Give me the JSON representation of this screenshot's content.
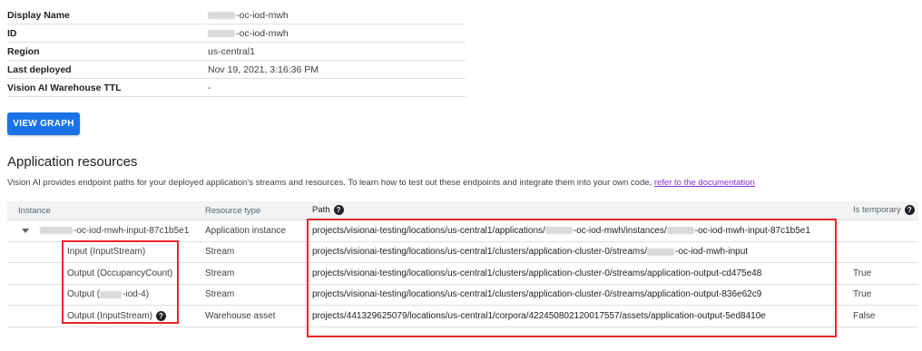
{
  "properties": [
    {
      "key": "Display Name",
      "value": "-oc-iod-mwh"
    },
    {
      "key": "ID",
      "value": "-oc-iod-mwh"
    },
    {
      "key": "Region",
      "value": "us-central1"
    },
    {
      "key": "Last deployed",
      "value": "Nov 19, 2021, 3:16:36 PM"
    },
    {
      "key": "Vision AI Warehouse TTL",
      "value": "-"
    }
  ],
  "view_graph_label": "VIEW GRAPH",
  "resources": {
    "title": "Application resources",
    "description": "Vision AI provides endpoint paths for your deployed application's streams and resources. To learn how to test out these endpoints and integrate them into your own code,",
    "doc_link": "refer to the documentation",
    "columns": {
      "instance": "Instance",
      "type": "Resource type",
      "path": "Path",
      "temporary": "Is temporary"
    },
    "rows": [
      {
        "instance_suffix": "-oc-iod-mwh-input-87c1b5e1",
        "type": "Application instance",
        "path_a": "projects/visionai-testing/locations/us-central1/applications/",
        "path_b": "-oc-iod-mwh/instances/",
        "path_c": "-oc-iod-mwh-input-87c1b5e1",
        "temporary": ""
      },
      {
        "instance": "Input (InputStream)",
        "type": "Stream",
        "path_a": "projects/visionai-testing/locations/us-central1/clusters/application-cluster-0/streams/",
        "path_b": "-oc-iod-mwh-input",
        "temporary": ""
      },
      {
        "instance": "Output (OccupancyCount)",
        "type": "Stream",
        "path": "projects/visionai-testing/locations/us-central1/clusters/application-cluster-0/streams/application-output-cd475e48",
        "temporary": "True"
      },
      {
        "instance_prefix": "Output (",
        "instance_suffix": "-iod-4)",
        "type": "Stream",
        "path": "projects/visionai-testing/locations/us-central1/clusters/application-cluster-0/streams/application-output-836e62c9",
        "temporary": "True"
      },
      {
        "instance": "Output (InputStream)",
        "type": "Warehouse asset",
        "path": "projects/441329625079/locations/us-central1/corpora/422450802120017557/assets/application-output-5ed8410e",
        "temporary": "False"
      }
    ]
  },
  "colors": {
    "accent": "#1a73e8",
    "highlight": "#e8262c",
    "link": "#8430ce"
  },
  "icons": {
    "help": "question-circle-icon",
    "expand": "caret-down-icon"
  }
}
